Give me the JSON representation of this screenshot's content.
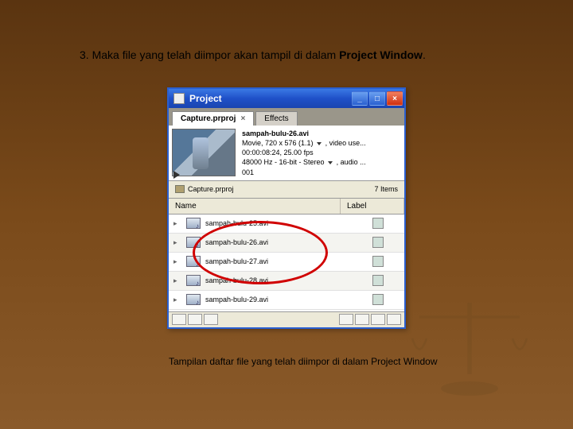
{
  "instruction_prefix": "3. Maka file yang telah diimpor akan tampil di dalam ",
  "instruction_bold": "Project Window",
  "instruction_suffix": ".",
  "caption": "Tampilan daftar file yang telah diimpor di dalam Project Window",
  "window": {
    "title": "Project",
    "tabs": {
      "active": "Capture.prproj",
      "inactive": "Effects"
    },
    "preview": {
      "filename": "sampah-bulu-26.avi",
      "line1a": "Movie, 720 x 576 (1.1)",
      "line1b": ", video use...",
      "line2": "00:00:08:24, 25.00 fps",
      "line3a": "48000 Hz - 16-bit - Stereo",
      "line3b": ", audio ...",
      "line4": "001"
    },
    "bin": {
      "name": "Capture.prproj",
      "count": "7 Items"
    },
    "columns": {
      "name": "Name",
      "label": "Label"
    },
    "files": [
      {
        "name": "sampah-bulu-25.avi"
      },
      {
        "name": "sampah-bulu-26.avi"
      },
      {
        "name": "sampah-bulu-27.avi"
      },
      {
        "name": "sampah-bulu-28.avi"
      },
      {
        "name": "sampah-bulu-29.avi"
      }
    ]
  }
}
